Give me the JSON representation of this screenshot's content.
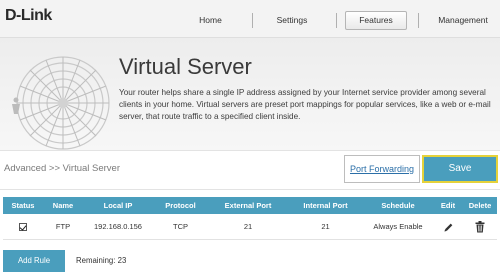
{
  "brand": {
    "logo_text": "D-Link"
  },
  "nav": {
    "tabs": [
      {
        "label": "Home"
      },
      {
        "label": "Settings"
      },
      {
        "label": "Features",
        "active": true
      },
      {
        "label": "Management"
      }
    ]
  },
  "header": {
    "title": "Virtual Server",
    "description": "Your router helps share a single IP address assigned by your Internet service provider among several clients in your home. Virtual servers are preset port mappings for popular services, like a web or e-mail server, that route traffic to a specified client inside."
  },
  "breadcrumb": {
    "text": "Advanced >> Virtual Server"
  },
  "actions": {
    "port_forwarding_label": "Port Forwarding",
    "save_label": "Save"
  },
  "table": {
    "headers": [
      "Status",
      "Name",
      "Local IP",
      "Protocol",
      "External Port",
      "Internal Port",
      "Schedule",
      "Edit",
      "Delete"
    ],
    "rows": [
      {
        "status_checked": true,
        "name": "FTP",
        "local_ip": "192.168.0.156",
        "protocol": "TCP",
        "external_port": "21",
        "internal_port": "21",
        "schedule": "Always Enable"
      }
    ]
  },
  "footer": {
    "add_rule_label": "Add Rule",
    "remaining_text": "Remaining: 23"
  },
  "colors": {
    "accent": "#4a9ebd",
    "save_border": "#e5d23a",
    "link": "#2b6fa8"
  },
  "icons": {
    "edit": "pencil-icon",
    "delete": "trash-icon",
    "header": "fan-icon"
  }
}
